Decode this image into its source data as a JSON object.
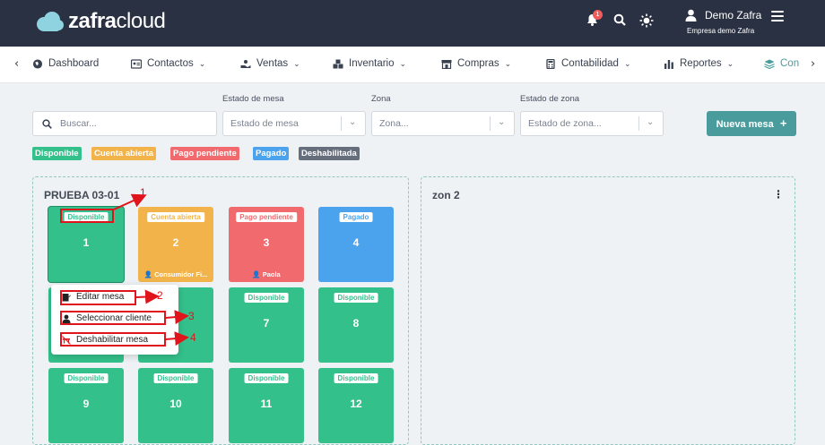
{
  "app": {
    "logo_bold": "zafra",
    "logo_light": "cloud"
  },
  "topbar": {
    "notification_count": "1",
    "user_name": "Demo Zafra",
    "company": "Empresa demo Zafra"
  },
  "nav": {
    "items": [
      "Dashboard",
      "Contactos",
      "Ventas",
      "Inventario",
      "Compras",
      "Contabilidad",
      "Reportes",
      "Con"
    ]
  },
  "filters": {
    "search_placeholder": "Buscar...",
    "estado_mesa_label": "Estado de mesa",
    "estado_mesa_placeholder": "Estado de mesa",
    "zona_label": "Zona",
    "zona_placeholder": "Zona...",
    "estado_zona_label": "Estado de zona",
    "estado_zona_placeholder": "Estado de zona...",
    "new_button": "Nueva mesa"
  },
  "legend": [
    "Disponible",
    "Cuenta abierta",
    "Pago pendiente",
    "Pagado",
    "Deshabilitada"
  ],
  "colors": {
    "disponible": "#34c08b",
    "cuenta_abierta": "#f2b44a",
    "pago_pendiente": "#f06a6e",
    "pagado": "#4ba3ee",
    "deshabilitada": "#666e7c",
    "accent": "#4a9c9c"
  },
  "zones": [
    {
      "title": "PRUEBA 03-01"
    },
    {
      "title": "zon 2"
    }
  ],
  "tables": [
    {
      "status": "Disponible",
      "number": "1",
      "customer": ""
    },
    {
      "status": "Cuenta abierta",
      "number": "2",
      "customer": "Consumidor Fi..."
    },
    {
      "status": "Pago pendiente",
      "number": "3",
      "customer": "Paola"
    },
    {
      "status": "Pagado",
      "number": "4",
      "customer": ""
    },
    {
      "status": "Disponible",
      "number": "7",
      "customer": ""
    },
    {
      "status": "Disponible",
      "number": "8",
      "customer": ""
    },
    {
      "status": "Disponible",
      "number": "9",
      "customer": ""
    },
    {
      "status": "Disponible",
      "number": "10",
      "customer": ""
    },
    {
      "status": "Disponible",
      "number": "11",
      "customer": ""
    },
    {
      "status": "Disponible",
      "number": "12",
      "customer": ""
    }
  ],
  "popup": {
    "edit": "Editar mesa",
    "select_client": "Seleccionar cliente",
    "disable": "Deshabilitar mesa"
  },
  "annotations": [
    "1",
    "2",
    "3",
    "4"
  ]
}
